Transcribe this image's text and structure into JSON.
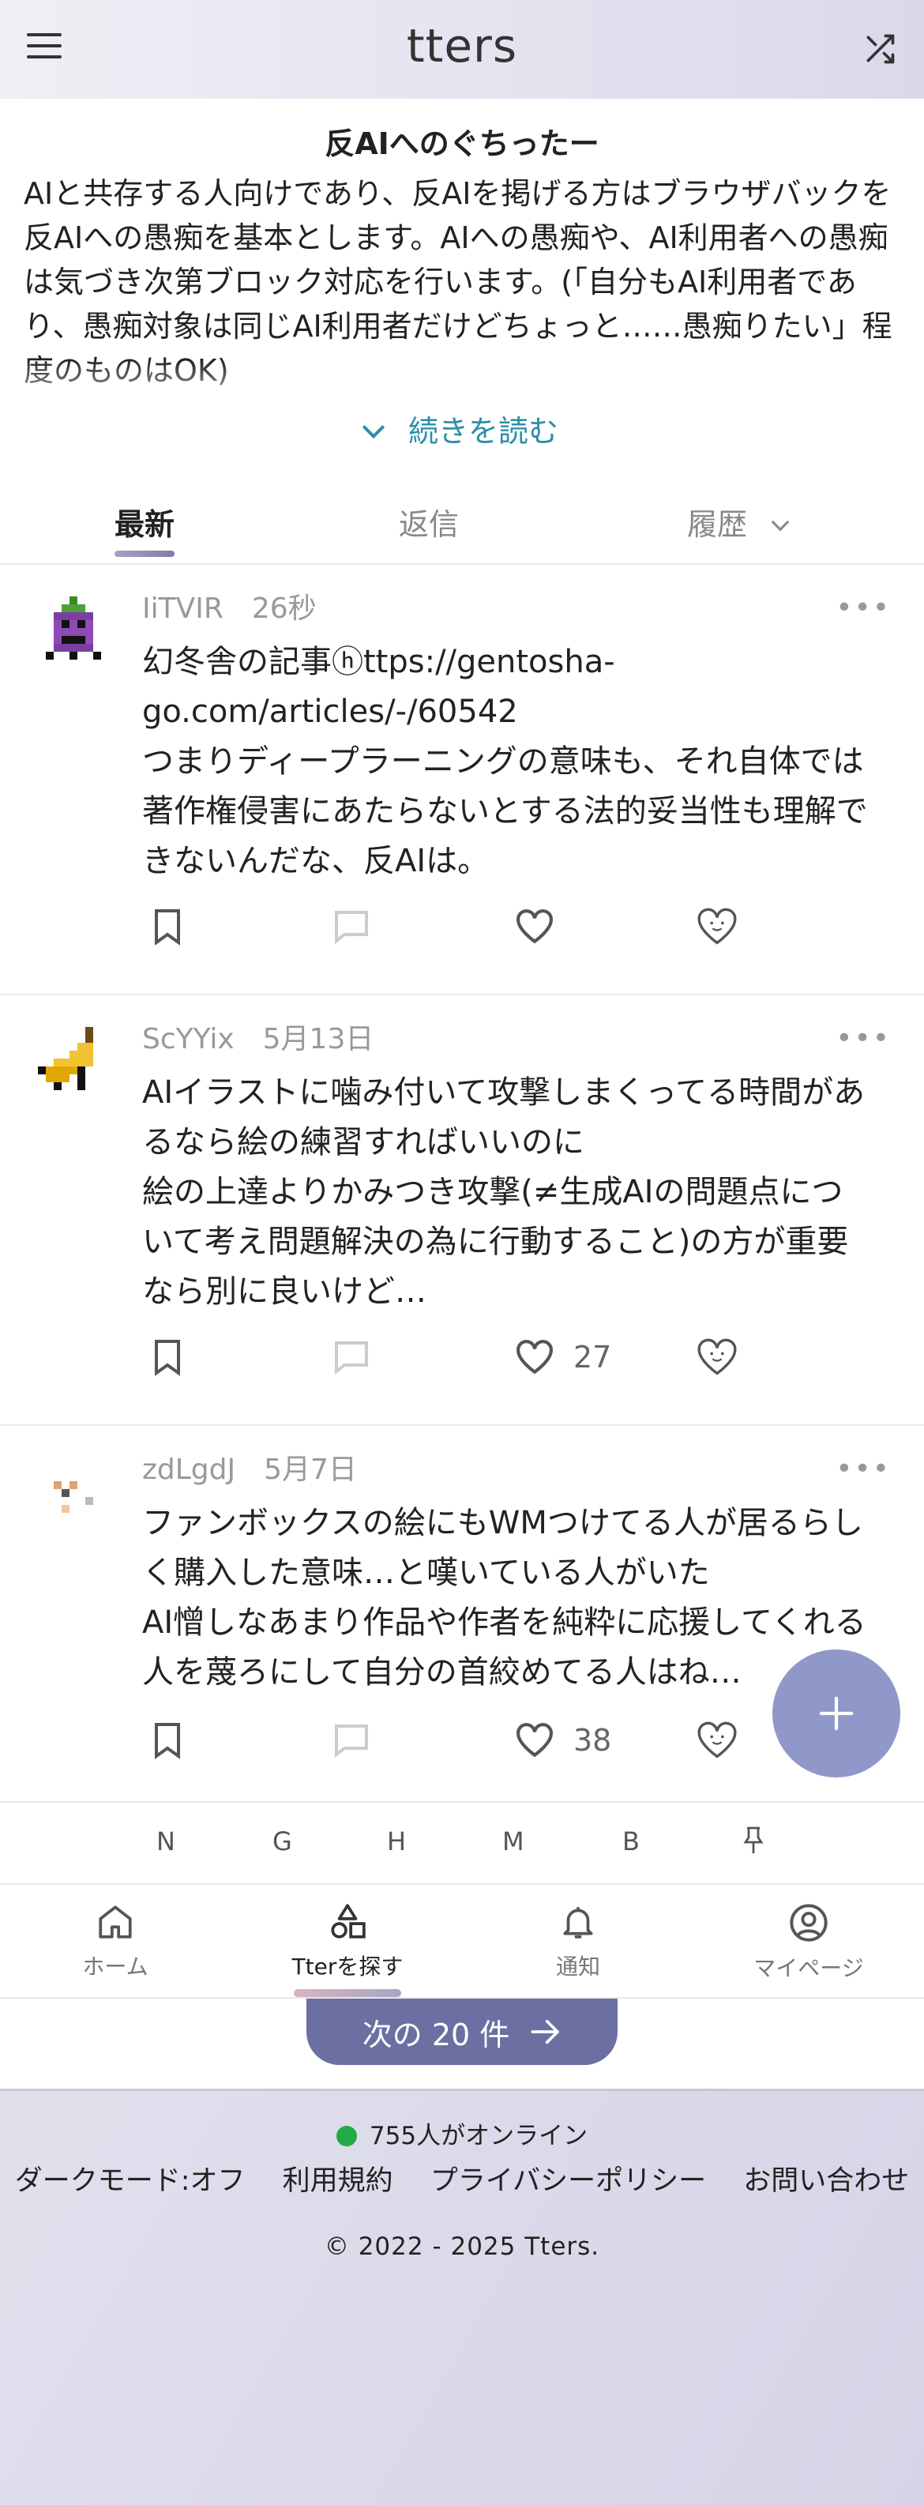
{
  "header": {
    "logo": "tters"
  },
  "board": {
    "title": "反AIへのぐちったー",
    "description_lines": [
      "AIと共存する人向けであり、反AIを掲げる方はブラウザバックを",
      "反AIへの愚痴を基本とします。AIへの愚痴や、AI利用者への愚痴は気づき次第ブロック対応を行います。(「自分もAI利用者であり、愚痴対象は同じAI利用者だけどちょっと……愚痴りたい」程度のものはOK)"
    ],
    "read_more": "続きを読む"
  },
  "tabs": {
    "latest": "最新",
    "replies": "返信",
    "history": "履歴"
  },
  "posts": [
    {
      "user": "IiTVIR",
      "time": "26秒",
      "lines": [
        "幻冬舎の記事ⓗttps://gentosha-go.com/articles/-/60542",
        "つまりディープラーニングの意味も、それ自体では著作権侵害にあたらないとする法的妥当性も理解できないんだな、反AIは。"
      ],
      "like_count": ""
    },
    {
      "user": "ScYYix",
      "time": "5月13日",
      "lines": [
        "AIイラストに噛み付いて攻撃しまくってる時間があるなら絵の練習すればいいのに",
        "絵の上達よりかみつき攻撃(≠生成AIの問題点について考え問題解決の為に行動すること)の方が重要なら別に良いけど…"
      ],
      "like_count": "27"
    },
    {
      "user": "zdLgdJ",
      "time": "5月7日",
      "lines": [
        "ファンボックスの絵にもWMつけてる人が居るらしく購入した意味…と嘆いている人がいた",
        "AI憎しなあまり作品や作者を純粋に応援してくれる人を蔑ろにして自分の首絞めてる人はね…"
      ],
      "like_count": "38"
    }
  ],
  "quick_keys": [
    "N",
    "G",
    "H",
    "M",
    "B"
  ],
  "bottom_nav": {
    "home": "ホーム",
    "explore": "Tterを探す",
    "notifications": "通知",
    "mypage": "マイページ"
  },
  "pagination": {
    "next_label": "次の 20 件"
  },
  "footer": {
    "online": "755人がオンライン",
    "dark_mode": "ダークモード:オフ",
    "terms": "利用規約",
    "privacy": "プライバシーポリシー",
    "contact": "お問い合わせ",
    "copyright": "© 2022 - 2025 Tters."
  },
  "colors": {
    "accent": "#2b8ea8",
    "fab": "#8f98c8",
    "next_button": "#6b6fa2",
    "online_dot": "#22aa44"
  }
}
